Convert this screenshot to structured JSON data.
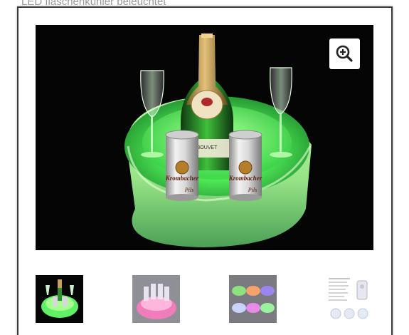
{
  "page": {
    "title": "LED flaschenkühler beleuchtet"
  },
  "gallery": {
    "zoom_icon": "zoom-in-icon",
    "main_image": {
      "bottle_label": "BOUVET",
      "can_label": "Krombacher",
      "can_sublabel": "Pils"
    },
    "thumbnails": [
      {
        "icon": "green-led-cooler-thumbnail"
      },
      {
        "icon": "pink-led-cooler-thumbnail"
      },
      {
        "icon": "multicolor-led-bowls-thumbnail"
      },
      {
        "icon": "product-spec-sheet-thumbnail"
      }
    ]
  },
  "colors": {
    "led_green": "#4dff5a",
    "frame_border": "#3a3a3a",
    "title_gray": "#9a9a9a"
  }
}
